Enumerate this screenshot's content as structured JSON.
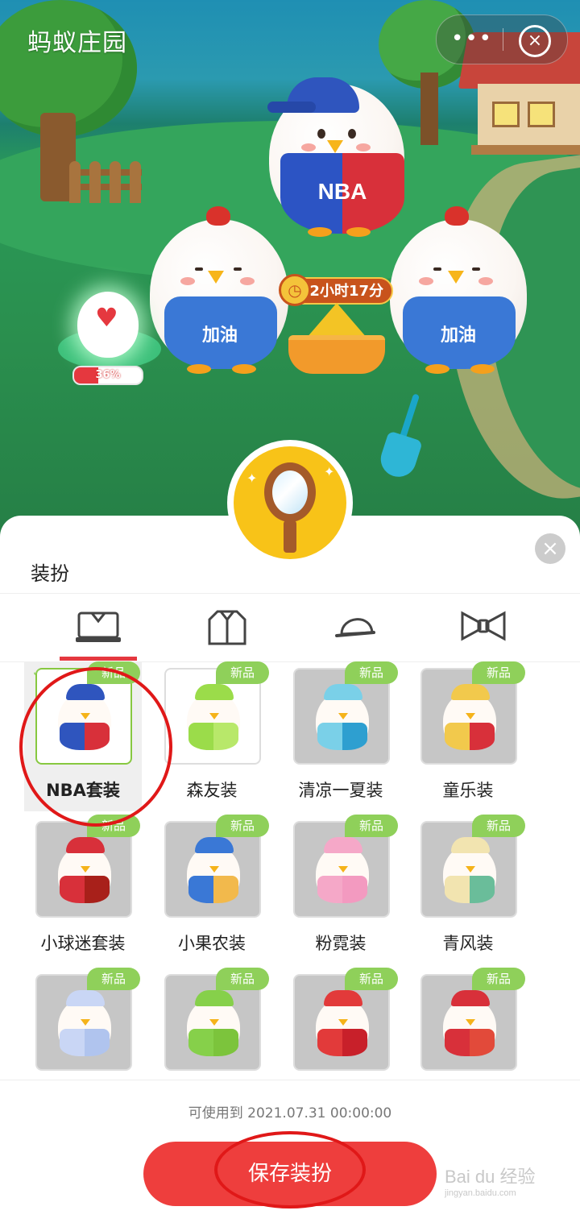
{
  "header": {
    "title": "蚂蚁庄园",
    "more_glyph": "•••",
    "close_glyph": "×"
  },
  "scene": {
    "timer_text": "2小时17分",
    "energy_percent": 36,
    "energy_text": "36%",
    "nba_badge": "NBA",
    "chick_badge_left": "加油",
    "chick_badge_right": "加油"
  },
  "panel": {
    "title": "装扮",
    "close_glyph": "×",
    "tabs": [
      {
        "icon": "clothing-set-icon",
        "active": true
      },
      {
        "icon": "jacket-icon",
        "active": false
      },
      {
        "icon": "cap-icon",
        "active": false
      },
      {
        "icon": "bow-tie-icon",
        "active": false
      }
    ],
    "new_tag": "新品",
    "items": [
      {
        "label": "NBA套装",
        "selected": true
      },
      {
        "label": "森友装",
        "selected": false
      },
      {
        "label": "清凉一夏装",
        "selected": false
      },
      {
        "label": "童乐装",
        "selected": false
      },
      {
        "label": "小球迷套装",
        "selected": false
      },
      {
        "label": "小果农装",
        "selected": false
      },
      {
        "label": "粉霓装",
        "selected": false
      },
      {
        "label": "青风装",
        "selected": false
      },
      {
        "label": "",
        "selected": false
      },
      {
        "label": "",
        "selected": false
      },
      {
        "label": "",
        "selected": false
      },
      {
        "label": "",
        "selected": false
      }
    ]
  },
  "footer": {
    "expiry": "可使用到 2021.07.31 00:00:00",
    "save_label": "保存装扮"
  },
  "watermark": {
    "brand": "Bai du 经验",
    "url": "jingyan.baidu.com"
  },
  "colors": {
    "accent": "#ee3e3d",
    "new_tag": "#8fd05a",
    "selected_border": "#87c840"
  }
}
